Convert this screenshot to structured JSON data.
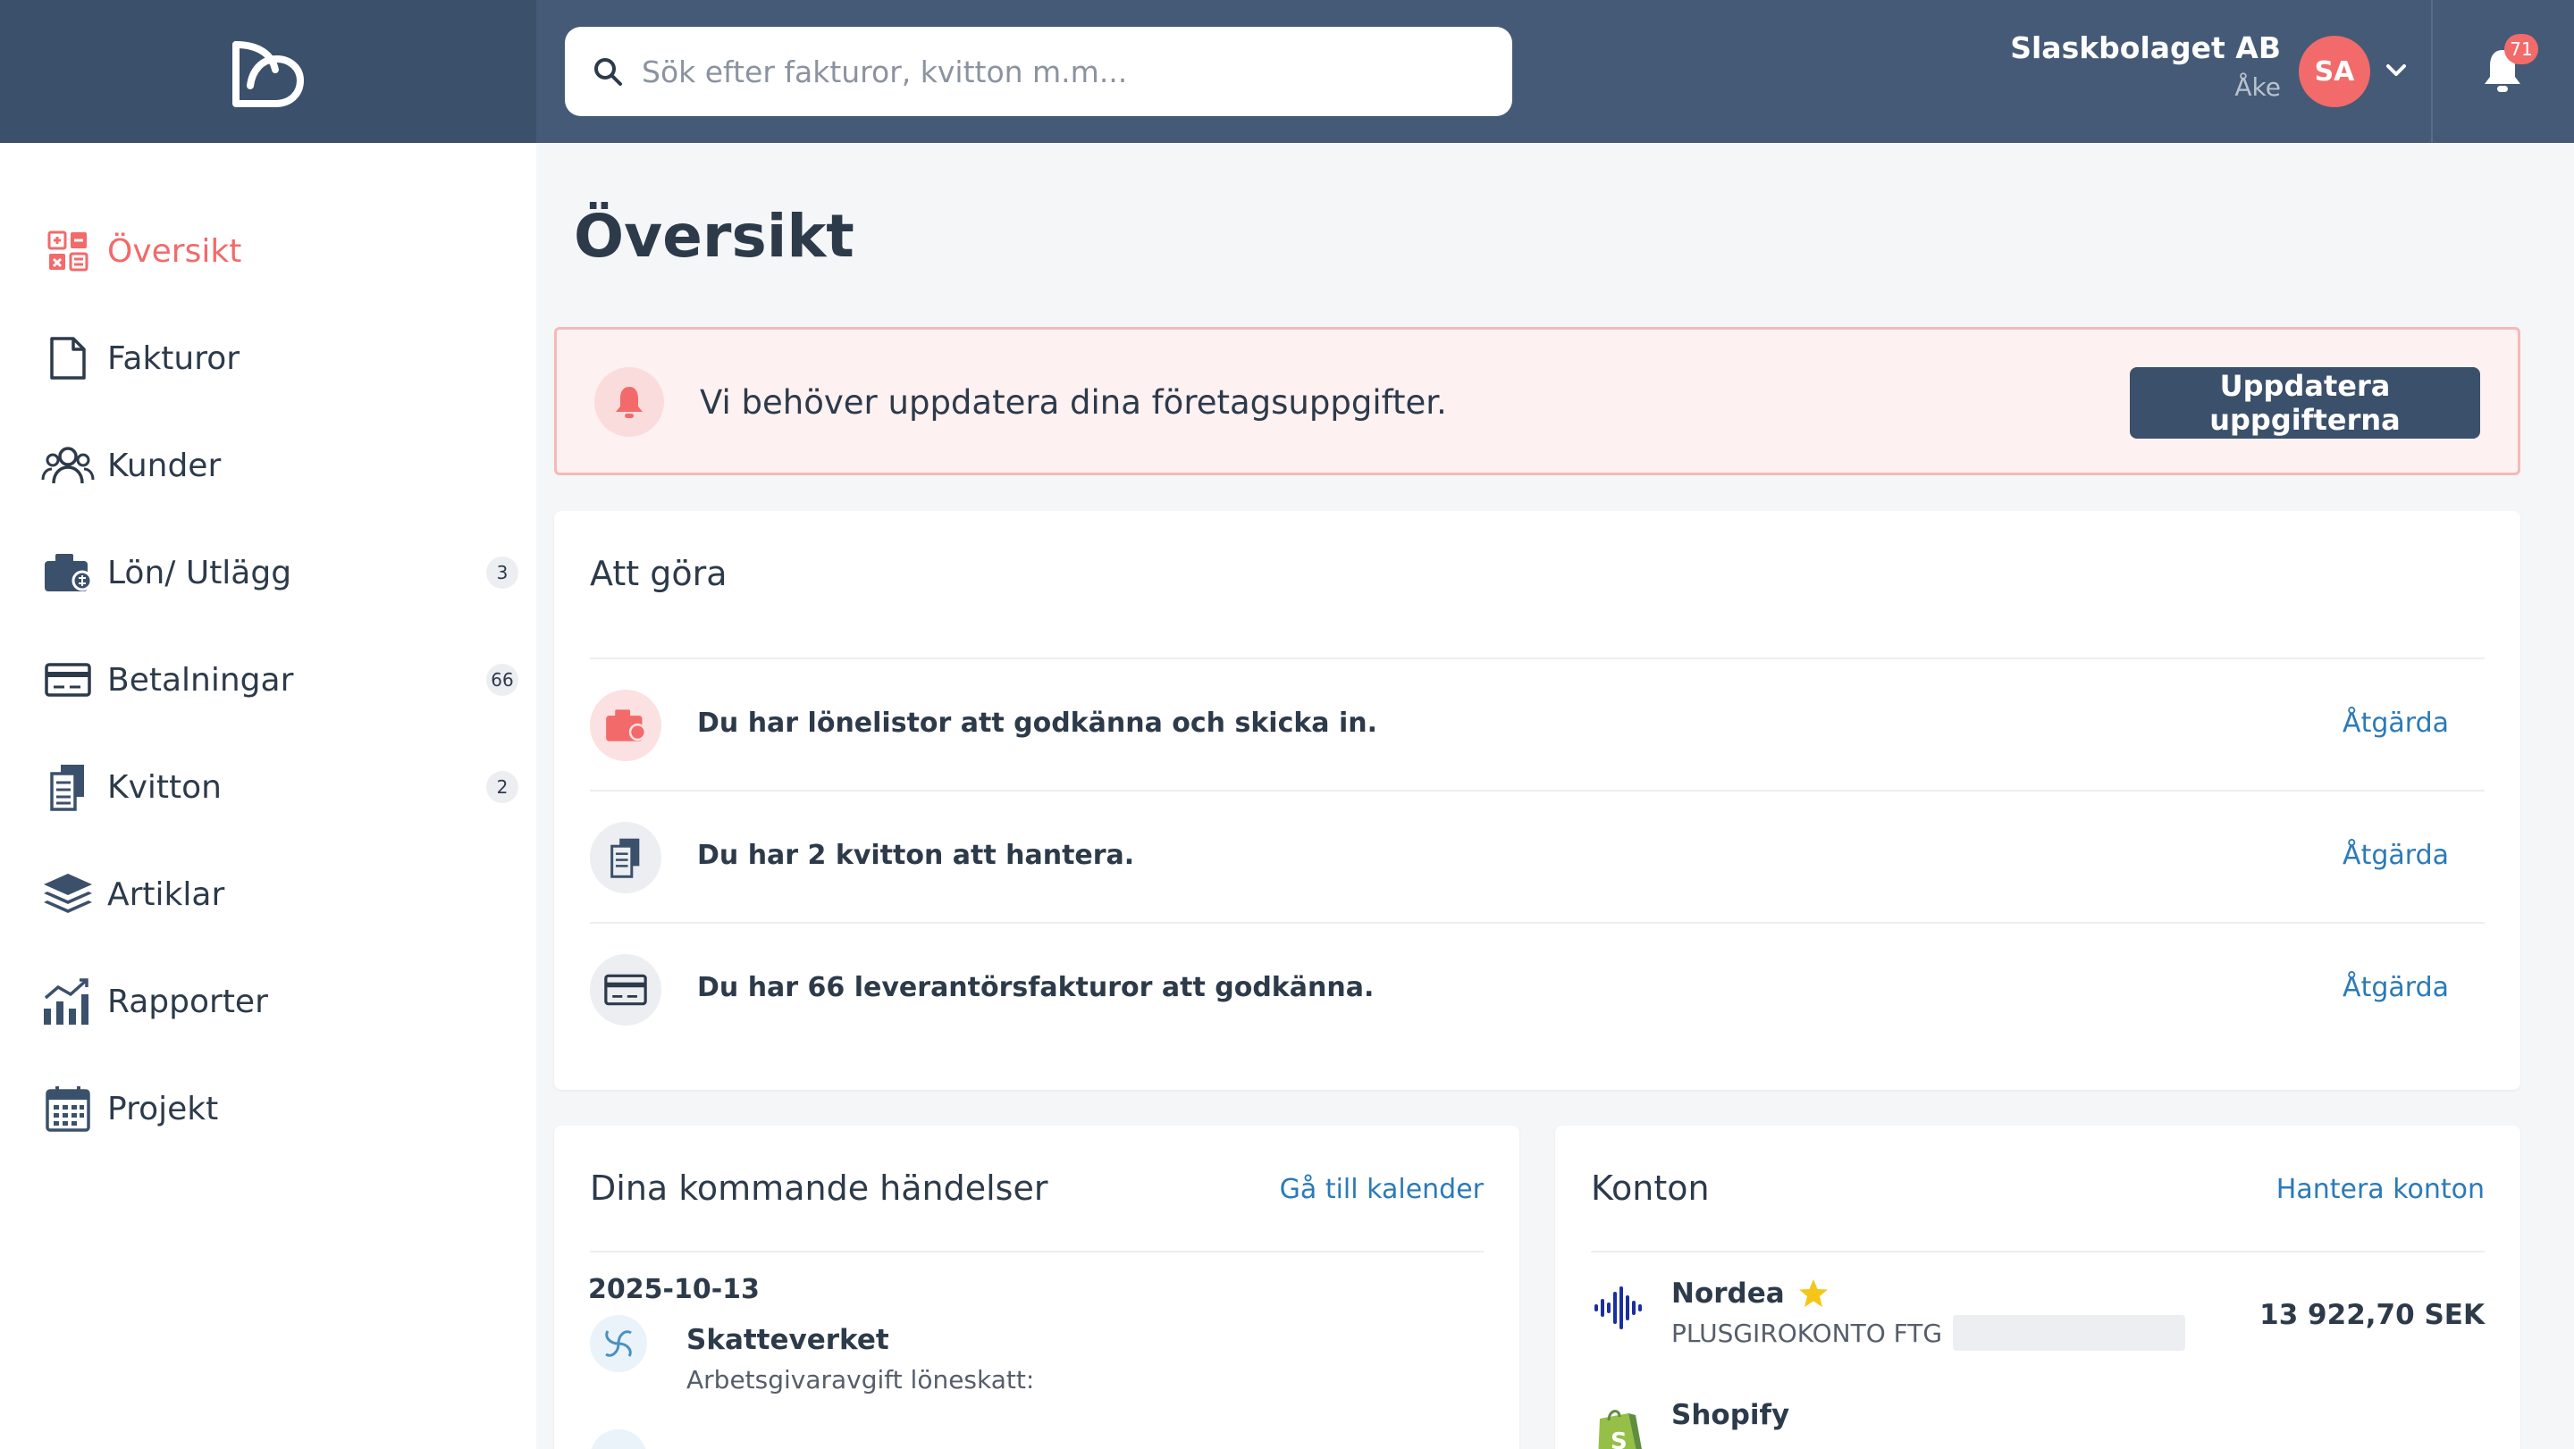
{
  "brand": {
    "accent": "#f26a6a",
    "header_bg": "#445a76",
    "logo_bg": "#3b506b",
    "link": "#2b7ab8"
  },
  "search": {
    "placeholder": "Sök efter fakturor, kvitton m.m...",
    "value": "",
    "icon": "search-icon"
  },
  "header": {
    "company": "Slaskbolaget AB",
    "user": "Åke",
    "avatar_initials": "SA",
    "notifications_count": "71"
  },
  "sidebar": {
    "items": [
      {
        "label": "Översikt",
        "icon": "dashboard-icon",
        "active": true
      },
      {
        "label": "Fakturor",
        "icon": "document-icon"
      },
      {
        "label": "Kunder",
        "icon": "users-icon"
      },
      {
        "label": "Lön/ Utlägg",
        "icon": "wallet-icon",
        "count": "3"
      },
      {
        "label": "Betalningar",
        "icon": "credit-card-icon",
        "count": "66"
      },
      {
        "label": "Kvitton",
        "icon": "receipt-icon",
        "count": "2"
      },
      {
        "label": "Artiklar",
        "icon": "layers-icon"
      },
      {
        "label": "Rapporter",
        "icon": "chart-icon"
      },
      {
        "label": "Projekt",
        "icon": "calendar-icon"
      }
    ]
  },
  "page": {
    "title": "Översikt"
  },
  "alert": {
    "message": "Vi behöver uppdatera dina företagsuppgifter.",
    "button": "Uppdatera uppgifterna"
  },
  "todo": {
    "title": "Att göra",
    "rows": [
      {
        "text": "Du har lönelistor att godkänna och skicka in.",
        "action": "Åtgärda",
        "icon": "wallet-icon"
      },
      {
        "text": "Du har 2 kvitton att hantera.",
        "action": "Åtgärda",
        "icon": "receipt-icon"
      },
      {
        "text": "Du har 66 leverantörsfakturor att godkänna.",
        "action": "Åtgärda",
        "icon": "credit-card-icon"
      }
    ]
  },
  "events": {
    "title": "Dina kommande händelser",
    "link": "Gå till kalender",
    "date": "2025-10-13",
    "items": [
      {
        "name": "Skatteverket",
        "desc": "Arbetsgivaravgift löneskatt:"
      }
    ]
  },
  "accounts": {
    "title": "Konton",
    "link": "Hantera konton",
    "items": [
      {
        "name": "Nordea",
        "sub": "PLUSGIROKONTO FTG",
        "amount": "13 922,70 SEK",
        "favorite": true
      },
      {
        "name": "Shopify"
      }
    ]
  }
}
